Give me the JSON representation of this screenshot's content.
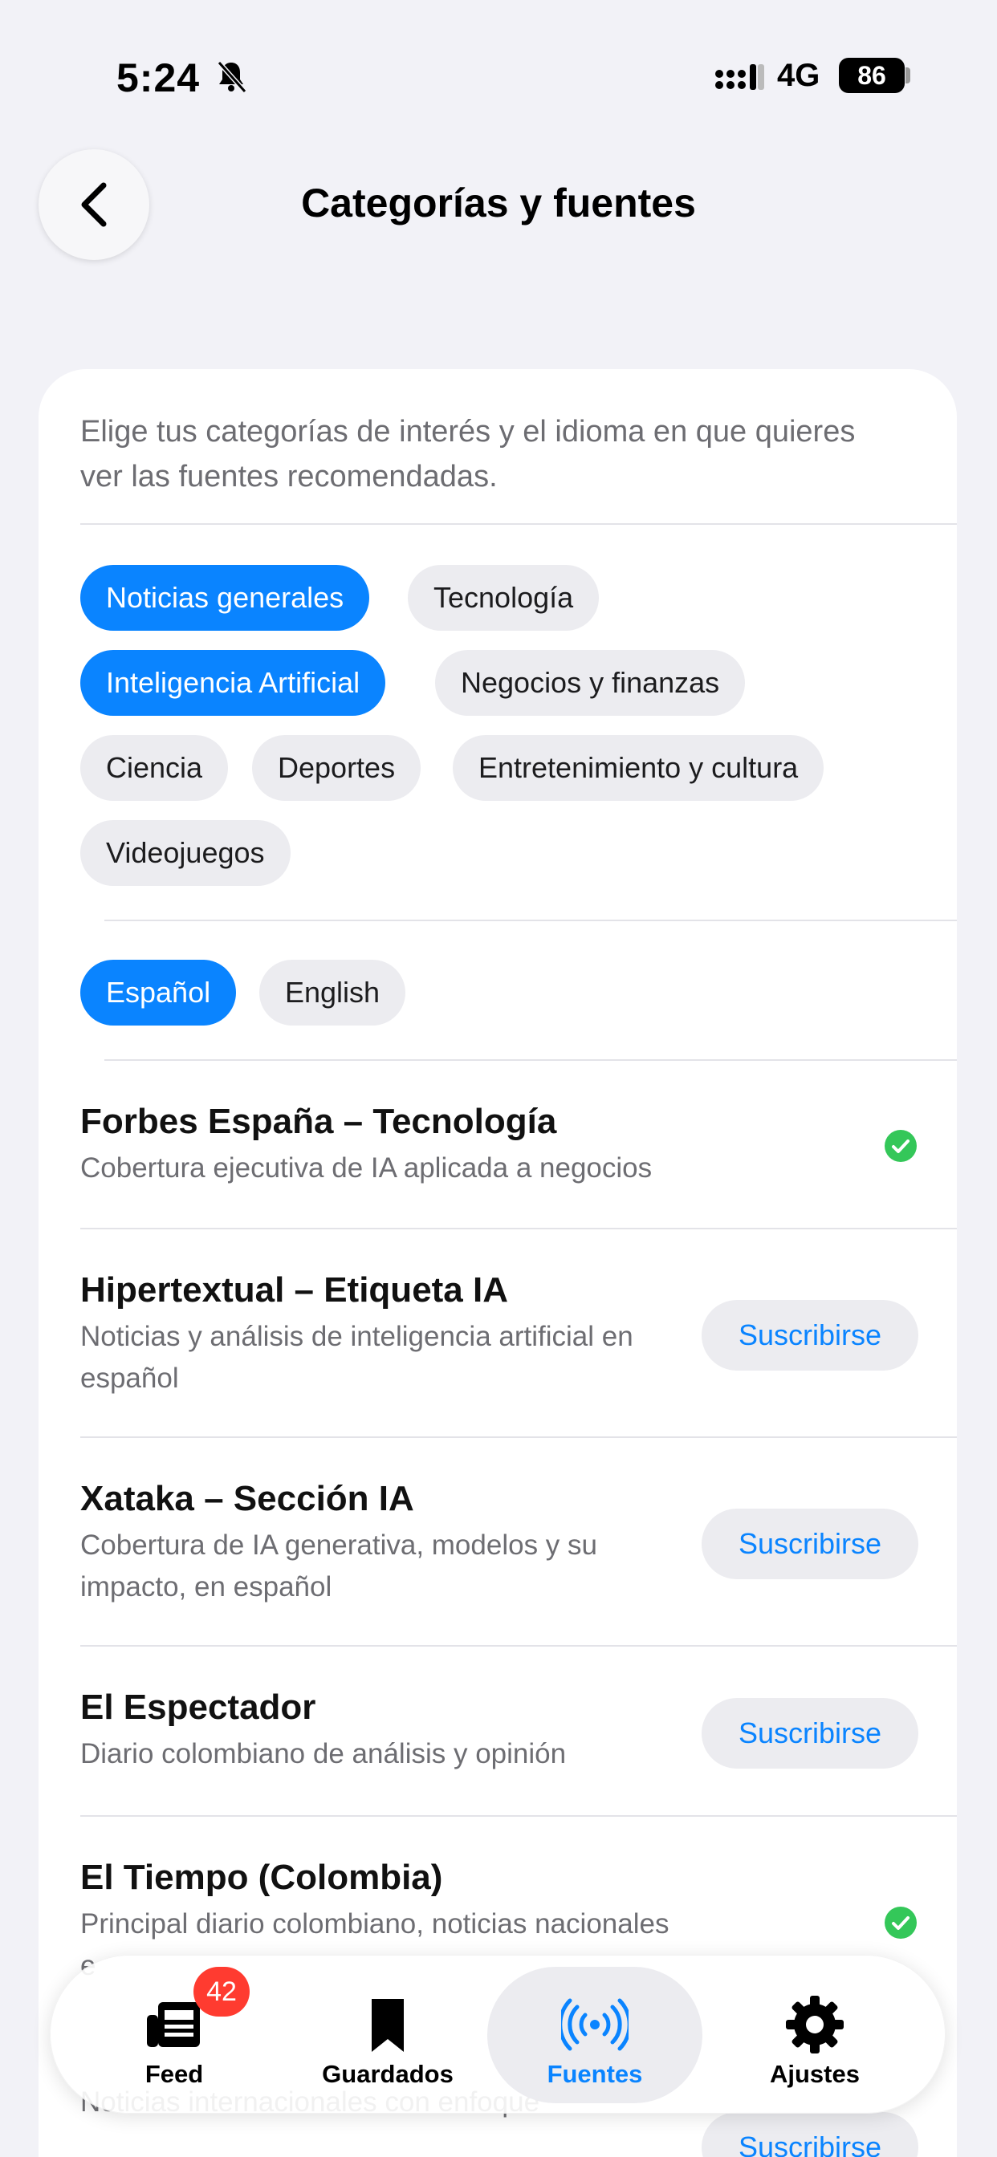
{
  "status_bar": {
    "time": "5:24",
    "network": "4G",
    "battery": "86"
  },
  "header": {
    "title": "Categorías y fuentes"
  },
  "card": {
    "intro": "Elige tus categorías de interés y el idioma en que quieres ver las fuentes recomendadas.",
    "categories": [
      {
        "label": "Noticias generales",
        "selected": true
      },
      {
        "label": "Tecnología",
        "selected": false
      },
      {
        "label": "Inteligencia Artificial",
        "selected": true
      },
      {
        "label": "Negocios y finanzas",
        "selected": false
      },
      {
        "label": "Ciencia",
        "selected": false
      },
      {
        "label": "Deportes",
        "selected": false
      },
      {
        "label": "Entretenimiento y cultura",
        "selected": false
      },
      {
        "label": "Videojuegos",
        "selected": false
      }
    ],
    "languages": [
      {
        "label": "Español",
        "selected": true
      },
      {
        "label": "English",
        "selected": false
      }
    ],
    "sources": [
      {
        "name": "Forbes España – Tecnología",
        "description": "Cobertura ejecutiva de IA aplicada a negocios",
        "subscribed": true
      },
      {
        "name": "Hipertextual – Etiqueta IA",
        "description": "Noticias y análisis de inteligencia artificial en español",
        "subscribed": false,
        "action": "Suscribirse"
      },
      {
        "name": "Xataka – Sección IA",
        "description": "Cobertura de IA generativa, modelos y su impacto, en español",
        "subscribed": false,
        "action": "Suscribirse"
      },
      {
        "name": "El Espectador",
        "description": "Diario colombiano de análisis y opinión",
        "subscribed": false,
        "action": "Suscribirse"
      },
      {
        "name": "El Tiempo (Colombia)",
        "description": "Principal diario colombiano, noticias nacionales e",
        "subscribed": true
      },
      {
        "name": "",
        "description": "Noticias internacionales con enfoque",
        "subscribed": false,
        "action": "Suscribirse"
      }
    ]
  },
  "tabbar": {
    "tabs": [
      {
        "label": "Feed",
        "icon": "newspaper-icon",
        "badge": "42",
        "active": false
      },
      {
        "label": "Guardados",
        "icon": "bookmark-icon",
        "active": false
      },
      {
        "label": "Fuentes",
        "icon": "broadcast-icon",
        "active": true
      },
      {
        "label": "Ajustes",
        "icon": "gear-icon",
        "active": false
      }
    ]
  },
  "colors": {
    "accent": "#0a84ff",
    "subscribed": "#34c759",
    "badge": "#ff3b30",
    "background": "#f2f2f7"
  }
}
